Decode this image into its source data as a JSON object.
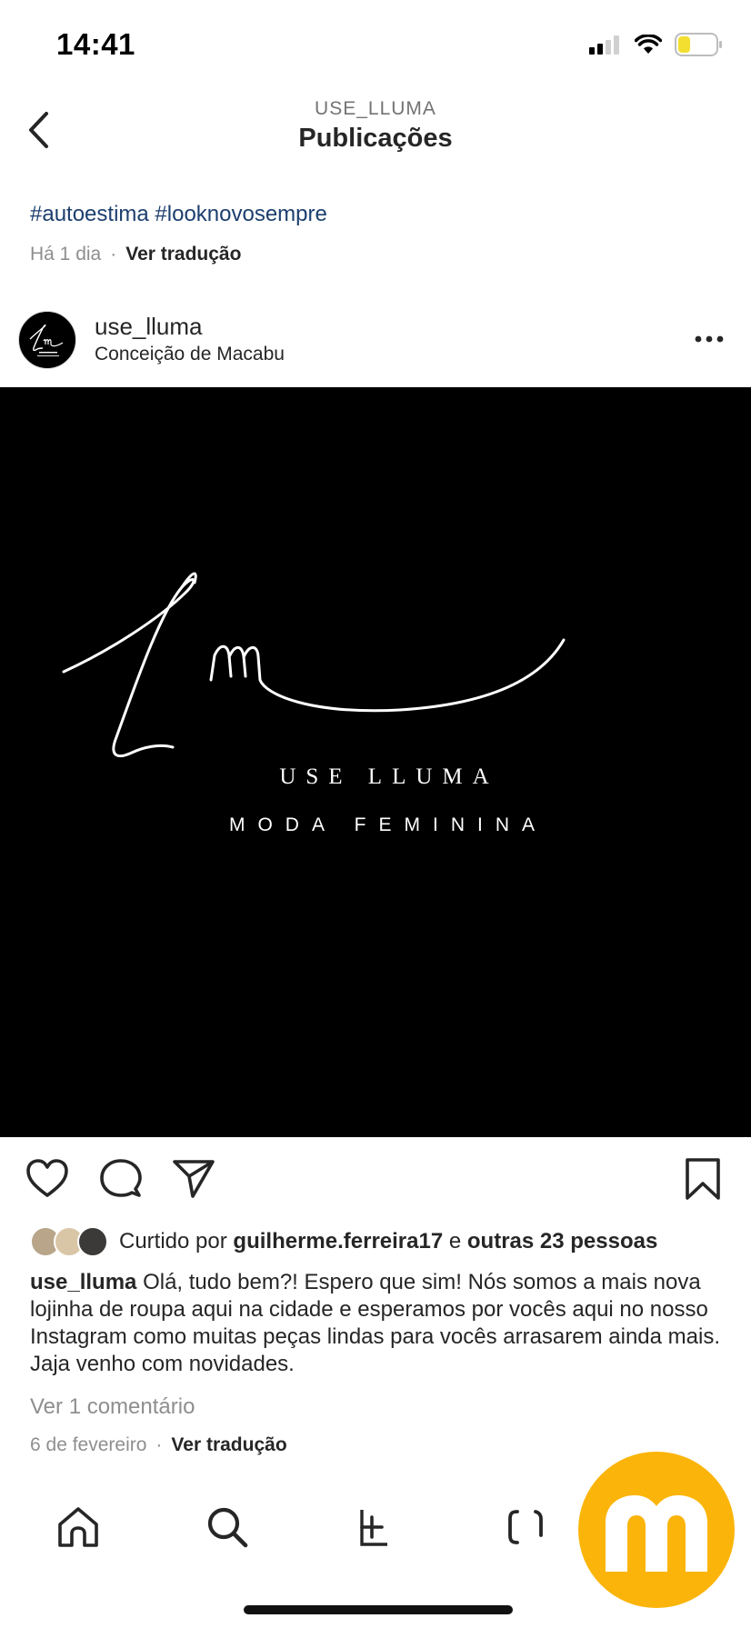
{
  "status": {
    "time": "14:41"
  },
  "header": {
    "account": "USE_LLUMA",
    "title": "Publicações"
  },
  "previous_post": {
    "caption": "#autoestima #looknovosempre",
    "time": "Há 1 dia",
    "separator": "·",
    "translate": "Ver tradução"
  },
  "post": {
    "username": "use_lluma",
    "location": "Conceição de Macabu",
    "image": {
      "logo_monogram": "Lm",
      "brand_line1": "USE LLUMA",
      "brand_line2": "MODA FEMININA"
    },
    "likes": {
      "prefix": "Curtido por",
      "user": "guilherme.ferreira17",
      "conj": "e",
      "others": "outras 23 pessoas"
    },
    "caption_user": "use_lluma",
    "caption_text": "Olá, tudo bem?! Espero que sim! Nós somos a mais nova lojinha de roupa aqui na cidade e esperamos por vocês aqui no nosso Instagram como muitas peças lindas para vocês arrasarem ainda mais. Jaja venho com novidades.",
    "view_comments": "Ver 1 comentário",
    "date": "6 de fevereiro",
    "separator": "·",
    "translate": "Ver tradução"
  },
  "icons": {
    "back": "chevron-left-icon",
    "more": "more-horizontal-icon",
    "like": "heart-icon",
    "comment": "comment-icon",
    "share": "send-icon",
    "save": "bookmark-icon",
    "tabs": [
      "home-icon",
      "search-icon",
      "new-post-icon",
      "reels-icon"
    ]
  },
  "overlay": {
    "letter": "m"
  },
  "colors": {
    "hashtag": "#1c3f6e",
    "muted": "#8e8e8e",
    "overlay": "#fbb409"
  }
}
